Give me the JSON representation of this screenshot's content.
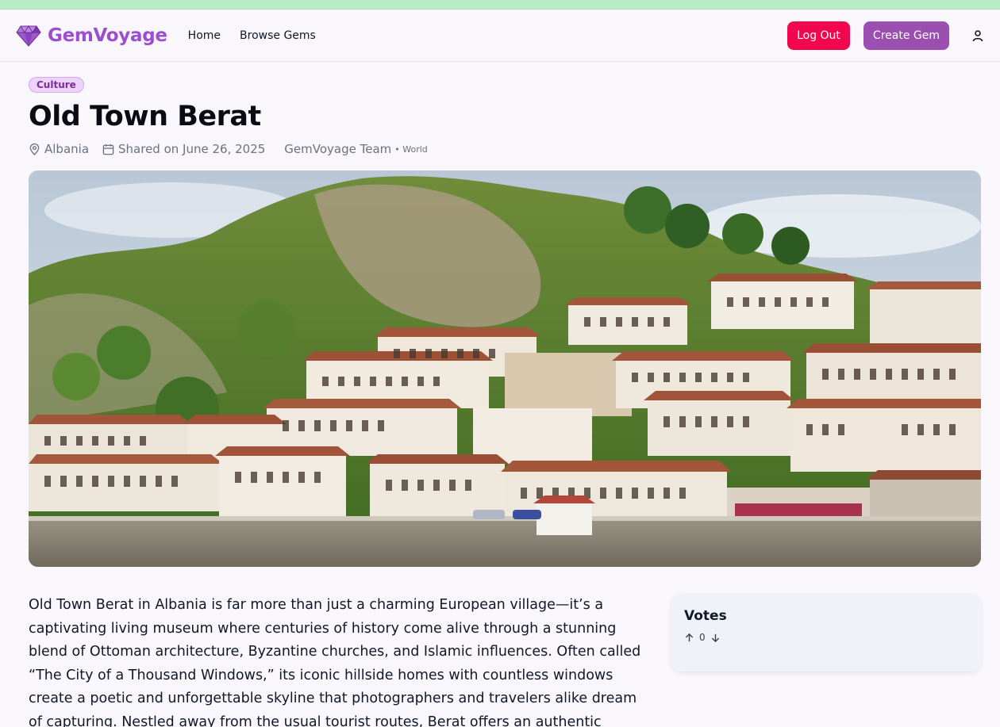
{
  "brand": {
    "name": "GemVoyage"
  },
  "nav": {
    "home": "Home",
    "browse": "Browse Gems"
  },
  "actions": {
    "logout": "Log Out",
    "create": "Create Gem"
  },
  "gem": {
    "category": "Culture",
    "title": "Old Town Berat",
    "location": "Albania",
    "shared": "Shared on June 26, 2025",
    "author": "GemVoyage Team",
    "author_region": "• World",
    "description": "Old Town Berat in Albania is far more than just a charming European village—it’s a captivating living museum where centuries of history come alive through a stunning blend of Ottoman architecture, Byzantine churches, and Islamic influences. Often called “The City of a Thousand Windows,” its iconic hillside homes with countless windows create a poetic and unforgettable skyline that photographers and travelers alike dream of capturing. Nestled away from the usual tourist routes, Berat offers an authentic glimpse into centuries of history..."
  },
  "votes": {
    "title": "Votes",
    "count": "0"
  },
  "colors": {
    "brand": "#9b4fd0",
    "logout": "#f2074e",
    "create": "#9b4fb0"
  },
  "icons": {
    "logo": "gem-icon",
    "user": "user-icon",
    "location": "map-pin-icon",
    "date": "calendar-icon",
    "upvote": "arrow-up-icon",
    "downvote": "arrow-down-icon"
  }
}
